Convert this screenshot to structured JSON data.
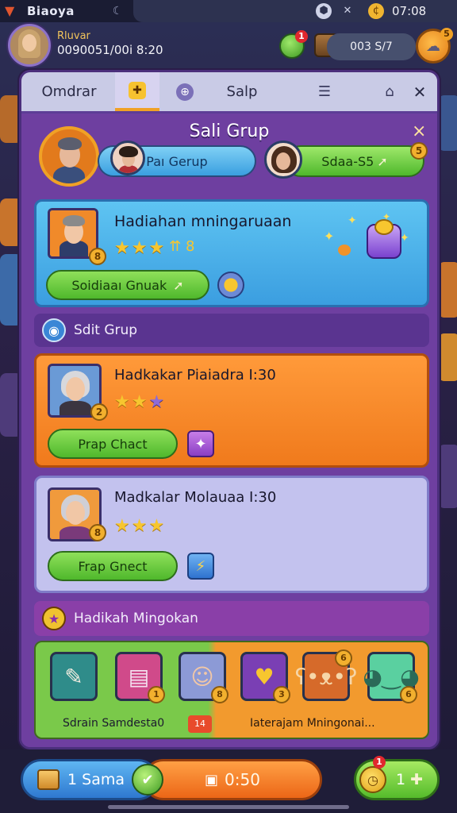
{
  "status": {
    "app_title": "Biaoya",
    "time": "07:08",
    "icons": [
      "app-logo-icon",
      "moon-icon",
      "shield-icon",
      "tools-icon",
      "coin-icon"
    ]
  },
  "header": {
    "player_name": "Rluvar",
    "player_sub": "0090051/00i 8:20",
    "coin_value": "003 S/7",
    "notif_count": "1",
    "badge_count": "5"
  },
  "tabs": {
    "items": [
      {
        "label": "Omdrar"
      },
      {
        "label": ""
      },
      {
        "label": ""
      },
      {
        "label": "Salp"
      }
    ],
    "selected_index": 1
  },
  "sheet": {
    "title": "Sali Grup",
    "close": "×",
    "group_bar_left": "Paı Gerup",
    "group_bar_right": "Sdaa-S5",
    "group_badge": "5"
  },
  "cards": {
    "reward": {
      "title": "Hadiahan mningaruaan",
      "stars": 3,
      "extra": "⇈ 8",
      "level": "8",
      "button": "Soidiaaı Gnuak"
    },
    "section1": "Sdit Grup",
    "card1": {
      "title": "Hadkakar Piaiadra I:30",
      "stars_filled": 2,
      "stars_total": 3,
      "level": "2",
      "button": "Prap Chact"
    },
    "card2": {
      "title": "Madkalar Molauaa I:30",
      "stars_filled": 3,
      "stars_total": 3,
      "level": "8",
      "button": "Frap Gnect"
    },
    "section2": "Hadikah Mingokan"
  },
  "shop": {
    "label_left": "Sdrain Samdesta0",
    "label_mid": "14",
    "label_right": "Iaterajam Mningonai...",
    "items": [
      {
        "icon": "scroll-icon",
        "badge": ""
      },
      {
        "icon": "book-icon",
        "badge": "1"
      },
      {
        "icon": "portrait-icon",
        "badge": "8"
      },
      {
        "icon": "gold-heart-icon",
        "badge": "3"
      },
      {
        "icon": "bear-icon",
        "badge": "6"
      },
      {
        "icon": "slime-icon",
        "badge": "6"
      }
    ]
  },
  "bottom": {
    "left_label": "1 Sama",
    "timer": "0:50",
    "right_label": "1",
    "right_badge": "1"
  },
  "colors": {
    "panel_purple": "#7b4ea8",
    "accent_orange": "#f29a2e",
    "accent_green": "#55bb2b",
    "accent_blue": "#3a9fe0"
  }
}
